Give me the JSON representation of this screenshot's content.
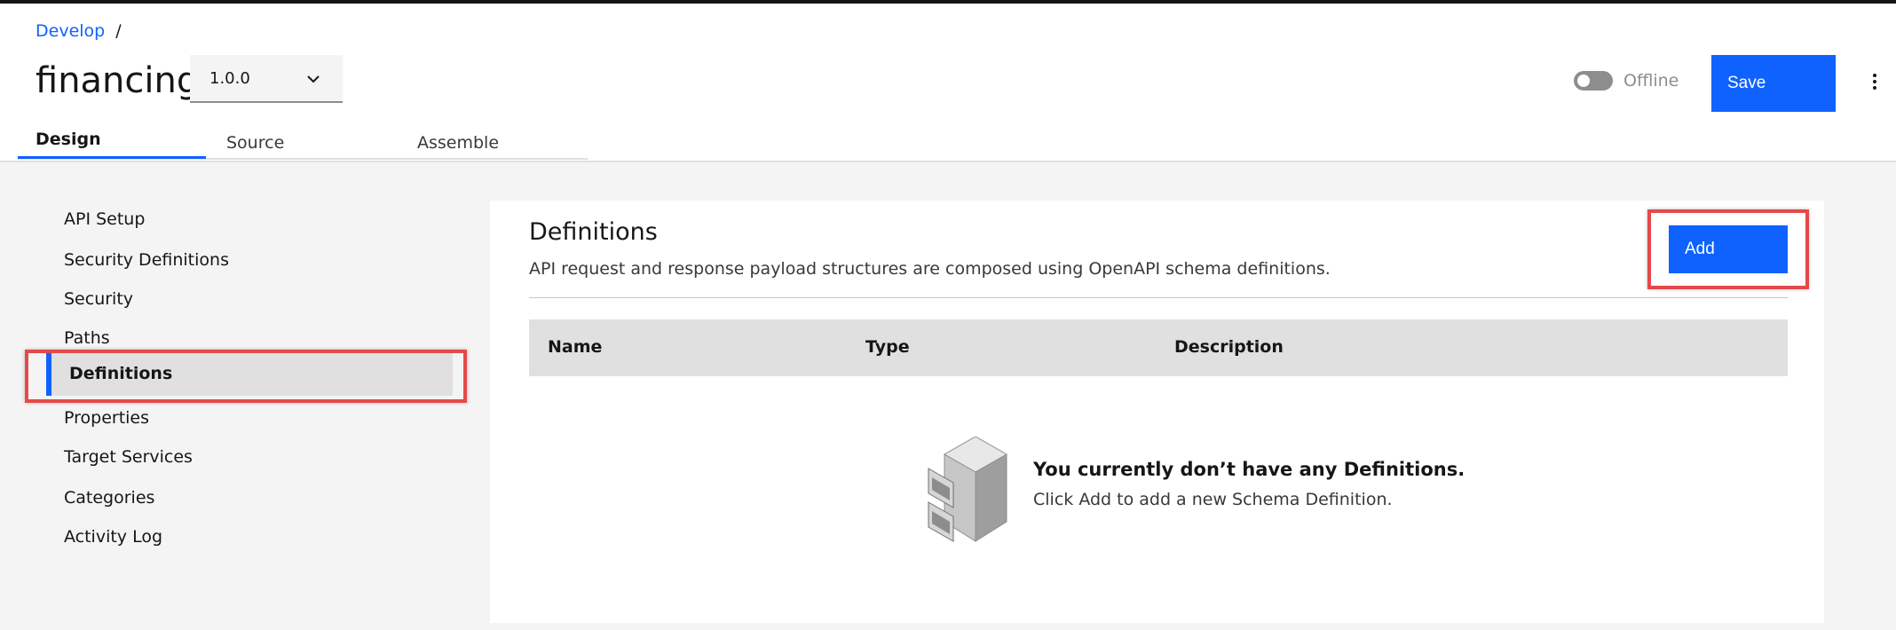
{
  "breadcrumb": {
    "link": "Develop",
    "separator": "/"
  },
  "page_title": "financing",
  "version_select": {
    "value": "1.0.0"
  },
  "status_toggle": {
    "label": "Offline"
  },
  "save_label": "Save",
  "tabs": [
    {
      "label": "Design",
      "active": true
    },
    {
      "label": "Source",
      "active": false
    },
    {
      "label": "Assemble",
      "active": false
    }
  ],
  "sidebar": {
    "items": [
      {
        "label": "API Setup"
      },
      {
        "label": "Security Definitions"
      },
      {
        "label": "Security"
      },
      {
        "label": "Paths"
      },
      {
        "label": "Definitions",
        "active": true
      },
      {
        "label": "Properties"
      },
      {
        "label": "Target Services"
      },
      {
        "label": "Categories"
      },
      {
        "label": "Activity Log"
      }
    ]
  },
  "panel": {
    "title": "Definitions",
    "description": "API request and response payload structures are composed using OpenAPI schema definitions.",
    "add_label": "Add",
    "table_headers": [
      "Name",
      "Type",
      "Description"
    ],
    "empty_state": {
      "title": "You currently don’t have any Definitions.",
      "subtitle": "Click Add to add a new Schema Definition.",
      "icon": "filing-cabinet-icon"
    }
  },
  "colors": {
    "accent": "#0f62fe",
    "highlight": "#e5494a",
    "background": "#f4f4f4"
  }
}
